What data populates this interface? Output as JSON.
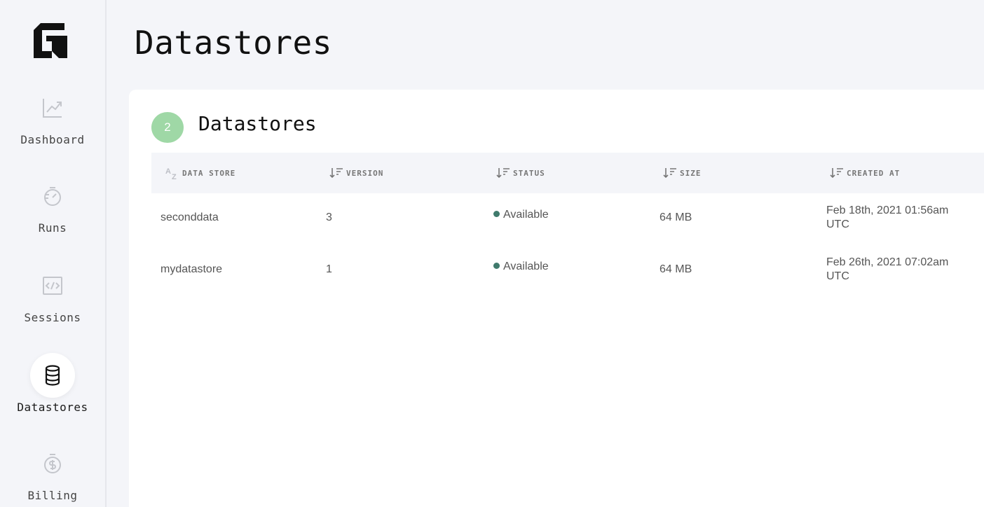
{
  "sidebar": {
    "logo": "G-logo",
    "items": [
      {
        "label": "Dashboard",
        "icon": "chart-line-icon",
        "active": false
      },
      {
        "label": "Runs",
        "icon": "stopwatch-icon",
        "active": false
      },
      {
        "label": "Sessions",
        "icon": "code-icon",
        "active": false
      },
      {
        "label": "Datastores",
        "icon": "database-icon",
        "active": true
      },
      {
        "label": "Billing",
        "icon": "dollar-icon",
        "active": false
      }
    ]
  },
  "page": {
    "title": "Datastores"
  },
  "card": {
    "count": "2",
    "title": "Datastores",
    "columns": [
      {
        "label": "Data Store",
        "icon": "az-sort-icon"
      },
      {
        "label": "Version",
        "icon": "sort-icon"
      },
      {
        "label": "Status",
        "icon": "sort-icon"
      },
      {
        "label": "Size",
        "icon": "sort-icon"
      },
      {
        "label": "Created At",
        "icon": "sort-icon"
      }
    ],
    "rows": [
      {
        "name": "seconddata",
        "version": "3",
        "status": "Available",
        "size": "64 MB",
        "created_line1": "Feb 18th, 2021 01:56am",
        "created_line2": "UTC"
      },
      {
        "name": "mydatastore",
        "version": "1",
        "status": "Available",
        "size": "64 MB",
        "created_line1": "Feb 26th, 2021 07:02am",
        "created_line2": "UTC"
      }
    ]
  },
  "colors": {
    "badge": "#9fd8a6",
    "status_dot": "#3f7a6c",
    "background": "#f4f5f9"
  }
}
